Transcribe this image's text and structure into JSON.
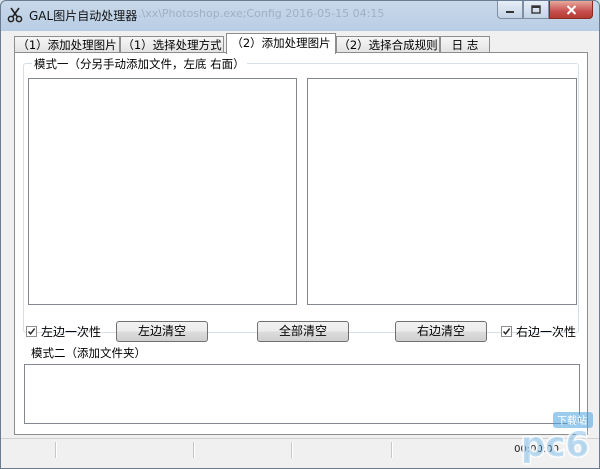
{
  "window": {
    "title": "GAL图片自动处理器",
    "ghost_title": "...\\xx\\Photoshop.exe;Config  2016-05-15 04:15"
  },
  "tabs": [
    {
      "label": "（1）添加处理图片",
      "active": false
    },
    {
      "label": "（1）选择处理方式",
      "active": false
    },
    {
      "label": "（2）添加处理图片",
      "active": true
    },
    {
      "label": "（2）选择合成规则",
      "active": false
    },
    {
      "label": "日 志",
      "active": false
    }
  ],
  "mode1": {
    "label": "模式一（分另手动添加文件，左底 右面）",
    "left_check_label": "左边一次性",
    "left_checked": true,
    "clear_left_label": "左边清空",
    "clear_all_label": "全部清空",
    "clear_right_label": "右边清空",
    "right_check_label": "右边一次性",
    "right_checked": true
  },
  "mode2": {
    "label": "模式二（添加文件夹）"
  },
  "statusbar": {
    "time": "00:00:00"
  },
  "watermark": {
    "text": "下载站"
  },
  "colors": {
    "titlebar": "#c9d8ea",
    "close_button": "#c75050",
    "panel": "#f0f0f0",
    "watermark": "#4aa3df"
  }
}
